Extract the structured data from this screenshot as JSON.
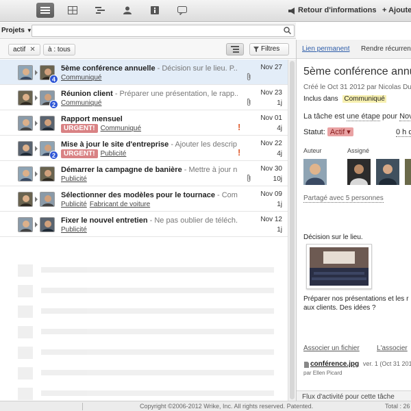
{
  "topbar": {
    "back_label": "Retour d'informations",
    "add_label": "+ Ajoute"
  },
  "search": {
    "projects_label": "Projets",
    "value": "",
    "placeholder": ""
  },
  "filters": {
    "chip_active": "actif",
    "chip_all": "à : tous",
    "filters_label": "Filtres"
  },
  "tasks": [
    {
      "title": "5ème conférence annuelle",
      "desc": " - Décision sur le lieu. P...",
      "tags": [
        "Communiqué"
      ],
      "urgent": false,
      "date": "Nov 27",
      "dur": "",
      "badge": "4",
      "clip": true,
      "excl": false
    },
    {
      "title": "Réunion client",
      "desc": " - Préparer une présentation, le rapp...",
      "tags": [
        "Communiqué"
      ],
      "urgent": false,
      "date": "Nov 23",
      "dur": "1j",
      "badge": "2",
      "clip": true,
      "excl": false
    },
    {
      "title": "Rapport mensuel",
      "desc": "",
      "tags": [
        "Communiqué"
      ],
      "urgent": true,
      "date": "Nov 01",
      "dur": "4j",
      "badge": "",
      "clip": false,
      "excl": true
    },
    {
      "title": "Mise à jour le site d'entreprise",
      "desc": " - Ajouter les descrip...",
      "tags": [
        "Publicité"
      ],
      "urgent": true,
      "date": "Nov 22",
      "dur": "4j",
      "badge": "2",
      "clip": false,
      "excl": true
    },
    {
      "title": "Démarrer la campagne de banière",
      "desc": " - Mettre à jour n...",
      "tags": [
        "Publicité"
      ],
      "urgent": false,
      "date": "Nov 30",
      "dur": "10j",
      "badge": "",
      "clip": true,
      "excl": false
    },
    {
      "title": "Sélectionner des modèles pour le tournace",
      "desc": " - Com...",
      "tags": [
        "Publicité",
        "Fabricant de voiture"
      ],
      "urgent": false,
      "date": "Nov 09",
      "dur": "1j",
      "badge": "",
      "clip": false,
      "excl": false
    },
    {
      "title": "Fixer le nouvel entretien",
      "desc": " - Ne pas oublier de téléch...",
      "tags": [
        "Publicité"
      ],
      "urgent": false,
      "date": "Nov 12",
      "dur": "1j",
      "badge": "",
      "clip": false,
      "excl": false
    }
  ],
  "urgent_label": "URGENT!",
  "detail": {
    "permalink": "Lien permanent",
    "recurring": "Rendre récurrent",
    "title": "5ème conférence annu",
    "created": "Créé le Oct 31 2012 par Nicolas Du",
    "included_label": "Inclus dans",
    "included_value": "Communiqué",
    "step_prefix": "La tâche est",
    "step_value": "une étape",
    "step_suffix": "pour",
    "step_date": "Nov",
    "status_label": "Statut:",
    "status_value": "Actif ▾",
    "hours": "0 h d",
    "author_label": "Auteur",
    "assigned_label": "Assigné",
    "shared": "Partagé avec 5 personnes",
    "desc1": "Décision sur le lieu.",
    "desc2": "Préparer nos présentations et les r",
    "desc3": "aux clients. Des idées ?",
    "attach_file": "Associer un fichier",
    "attach_other": "L'associer",
    "file_name": "conférence.jpg",
    "file_meta": "ver. 1 (Oct 31 2012",
    "file_by": "par Ellen Picard",
    "activity": "Flux d'activité pour cette tâche"
  },
  "footer": {
    "copyright": "Copyright ©2006-2012 Wrike, Inc. All rights reserved. Patented.",
    "total": "Total : 26"
  },
  "colors": {
    "accent_blue": "#2f57d6",
    "urgent": "#d98284",
    "selected_row": "#e3edf8",
    "tag_highlight": "#f7f0b0"
  }
}
